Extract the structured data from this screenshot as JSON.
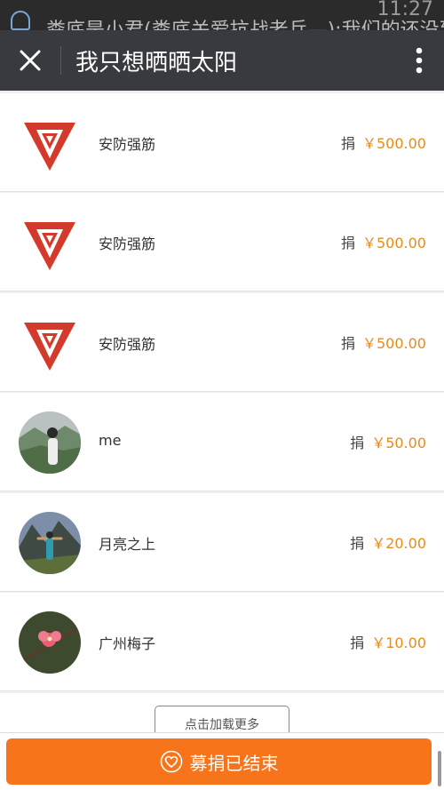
{
  "status_bar": {
    "ticker_text": "粪底是小君(粪底关爱抗战老兵—):我们的还没到",
    "time": "11:27"
  },
  "header": {
    "title": "我只想晒晒太阳",
    "close_icon": "close-icon",
    "more_icon": "more-vertical-icon"
  },
  "donations": [
    {
      "name": "安防强筋",
      "label": "捐",
      "amount": "￥500.00",
      "avatar": "red-v-logo"
    },
    {
      "name": "安防强筋",
      "label": "捐",
      "amount": "￥500.00",
      "avatar": "red-v-logo"
    },
    {
      "name": "安防强筋",
      "label": "捐",
      "amount": "￥500.00",
      "avatar": "red-v-logo"
    },
    {
      "name": "me",
      "label": "捐",
      "amount": "￥50.00",
      "avatar": "photo-person-mountains"
    },
    {
      "name": "月亮之上",
      "label": "捐",
      "amount": "￥20.00",
      "avatar": "photo-person-arms-outstretched"
    },
    {
      "name": "广州梅子",
      "label": "捐",
      "amount": "￥10.00",
      "avatar": "photo-plum-blossom"
    }
  ],
  "load_more_label": "点击加载更多",
  "footer": {
    "ended_label": "募捐已结束",
    "ended_icon": "heart-icon"
  },
  "colors": {
    "title_bar": "#393a3f",
    "accent_orange": "#f7741a",
    "amount_orange": "#e88b1a",
    "logo_red": "#d33a2c"
  }
}
